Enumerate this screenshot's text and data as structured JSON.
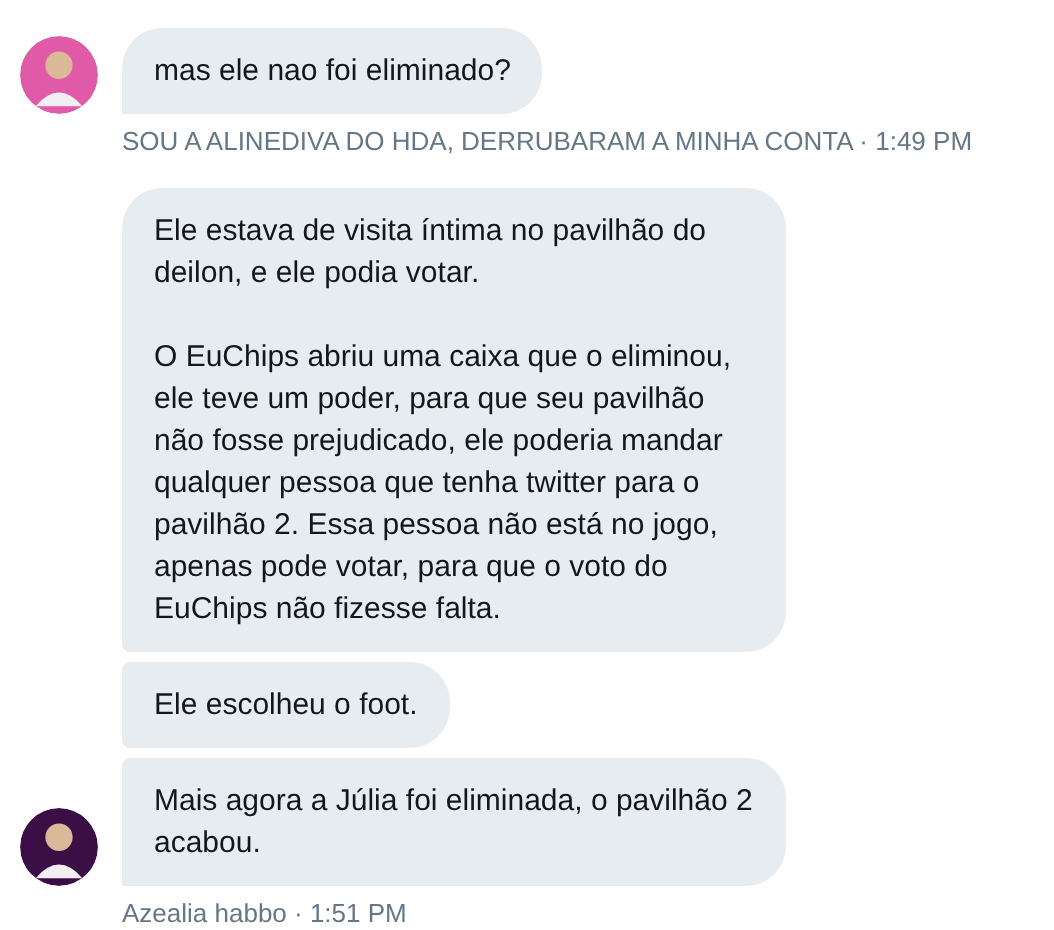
{
  "conversation": [
    {
      "avatar": {
        "color": "#e05aa8"
      },
      "messages": [
        {
          "paragraphs": [
            "mas ele nao foi eliminado?"
          ]
        }
      ],
      "meta": "SOU A ALINEDIVA DO HDA, DERRUBARAM A MINHA CONTA · 1:49 PM"
    },
    {
      "avatar": {
        "color": "#3b0f45"
      },
      "messages": [
        {
          "paragraphs": [
            "Ele estava de visita íntima no pavilhão do deilon, e ele podia votar.",
            "O EuChips abriu uma caixa que o eliminou, ele teve um poder, para que seu pavilhão não fosse prejudicado, ele poderia mandar qualquer pessoa que tenha twitter para o pavilhão 2. Essa pessoa não está no jogo, apenas pode votar, para que o voto do EuChips não fizesse falta."
          ]
        },
        {
          "paragraphs": [
            "Ele escolheu o foot."
          ]
        },
        {
          "paragraphs": [
            "Mais agora a Júlia foi eliminada, o pavilhão 2 acabou."
          ]
        }
      ],
      "meta": "Azealia habbo · 1:51 PM"
    }
  ]
}
